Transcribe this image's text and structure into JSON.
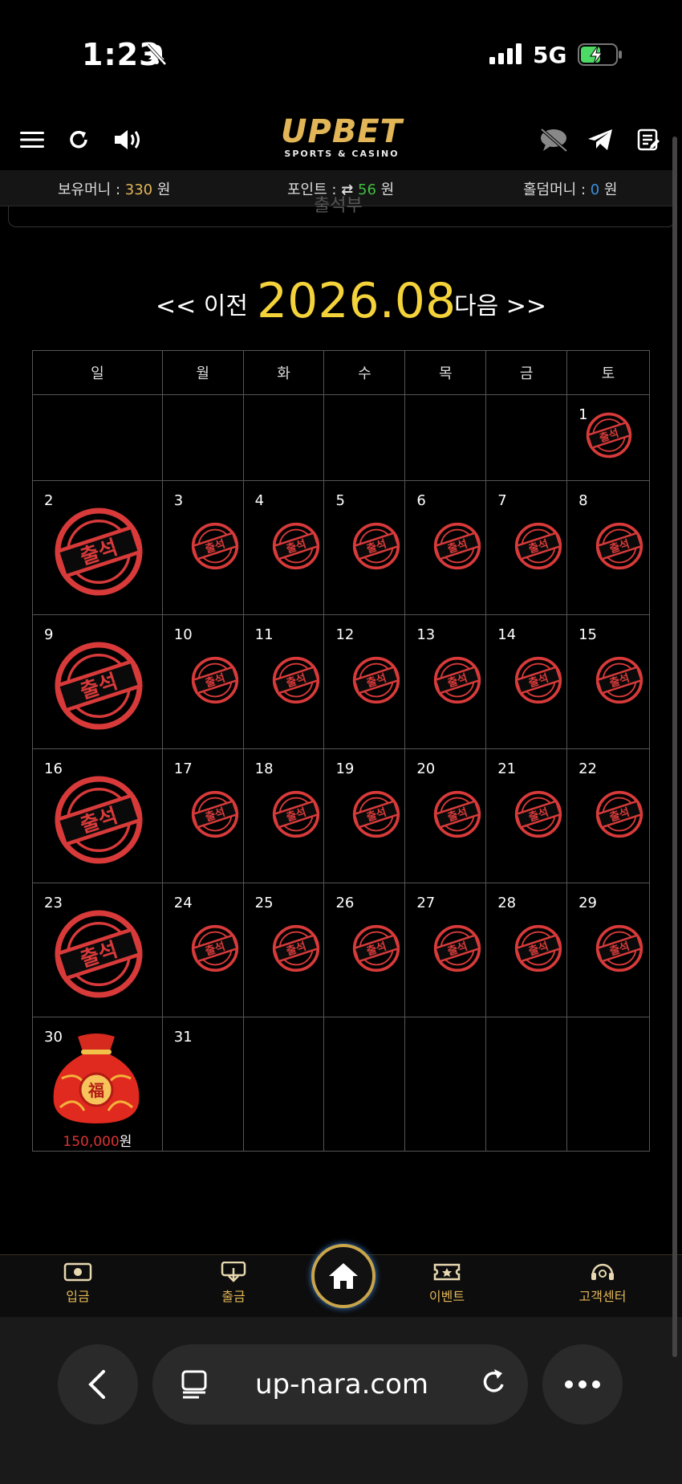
{
  "status": {
    "time": "1:23",
    "network": "5G"
  },
  "header": {
    "logo_main": "UPBET",
    "logo_sub": "SPORTS & CASINO"
  },
  "balance": {
    "money_label": "보유머니 : ",
    "money_value": "330",
    "money_unit": " 원",
    "point_label": "포인트 : ",
    "point_value": "56",
    "point_unit": " 원",
    "hold_label": "홀덤머니 : ",
    "hold_value": "0",
    "hold_unit": " 원"
  },
  "subtab": "출석부",
  "calendar": {
    "prev_label": "<< 이전",
    "current": "2026.08",
    "next_label": "다음 >>",
    "weekdays": [
      "일",
      "월",
      "화",
      "수",
      "목",
      "금",
      "토"
    ],
    "stamp_text": "출석",
    "prize_amount": "150,000",
    "prize_unit": "원",
    "weeks": [
      [
        "",
        "",
        "",
        "",
        "",
        "",
        "1"
      ],
      [
        "2",
        "3",
        "4",
        "5",
        "6",
        "7",
        "8"
      ],
      [
        "9",
        "10",
        "11",
        "12",
        "13",
        "14",
        "15"
      ],
      [
        "16",
        "17",
        "18",
        "19",
        "20",
        "21",
        "22"
      ],
      [
        "23",
        "24",
        "25",
        "26",
        "27",
        "28",
        "29"
      ],
      [
        "30",
        "31",
        "",
        "",
        "",
        "",
        ""
      ]
    ]
  },
  "bottom_nav": {
    "deposit": "입금",
    "withdraw": "출금",
    "event": "이벤트",
    "support": "고객센터"
  },
  "browser": {
    "url": "up-nara.com"
  },
  "colors": {
    "gold": "#e2b657",
    "yellow": "#f4d33a",
    "stamp_red": "#d83a3a"
  }
}
